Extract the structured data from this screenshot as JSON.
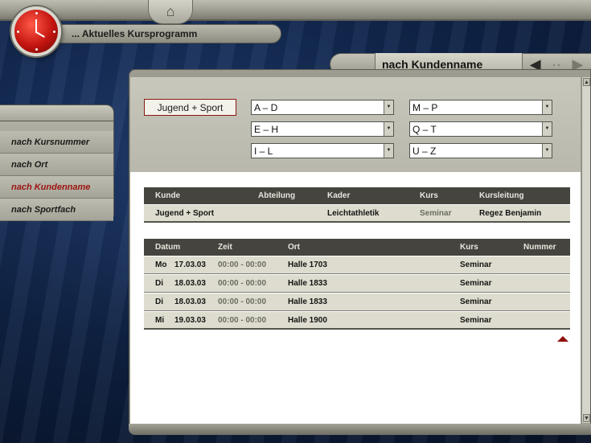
{
  "header": {
    "title": "... Aktuelles Kursprogramm",
    "mode_title": "nach Kundenname"
  },
  "menu": {
    "items": [
      {
        "label": "nach Kursnummer",
        "active": false
      },
      {
        "label": "nach Ort",
        "active": false
      },
      {
        "label": "nach Kundenname",
        "active": true
      },
      {
        "label": "nach Sportfach",
        "active": false
      }
    ]
  },
  "filters": {
    "customer_button": "Jugend + Sport",
    "ranges": [
      "A – D",
      "E – H",
      "I – L",
      "M – P",
      "Q – T",
      "U – Z"
    ]
  },
  "customer_table": {
    "headers": [
      "Kunde",
      "Abteilung",
      "Kader",
      "Kurs",
      "Kursleitung"
    ],
    "rows": [
      [
        "Jugend + Sport",
        "",
        "Leichtathletik",
        "Seminar",
        "Regez Benjamin"
      ]
    ]
  },
  "schedule_table": {
    "headers": [
      "Datum",
      "Zeit",
      "Ort",
      "Kurs",
      "Nummer"
    ],
    "rows": [
      {
        "day": "Mo",
        "date": "17.03.03",
        "time": "00:00 - 00:00",
        "place": "Halle 1703",
        "course": "Seminar",
        "number": ""
      },
      {
        "day": "Di",
        "date": "18.03.03",
        "time": "00:00 - 00:00",
        "place": "Halle 1833",
        "course": "Seminar",
        "number": ""
      },
      {
        "day": "Di",
        "date": "18.03.03",
        "time": "00:00 - 00:00",
        "place": "Halle 1833",
        "course": "Seminar",
        "number": ""
      },
      {
        "day": "Mi",
        "date": "19.03.03",
        "time": "00:00 - 00:00",
        "place": "Halle 1900",
        "course": "Seminar",
        "number": ""
      }
    ]
  },
  "icons": {
    "home": "home-icon",
    "clock": "clock-icon",
    "prev": "arrow-left-icon",
    "next": "arrow-right-icon",
    "sort": "sort-up-icon"
  },
  "colors": {
    "accent_red": "#9c1410",
    "table_header": "#45443e",
    "table_row": "#dddccf"
  }
}
